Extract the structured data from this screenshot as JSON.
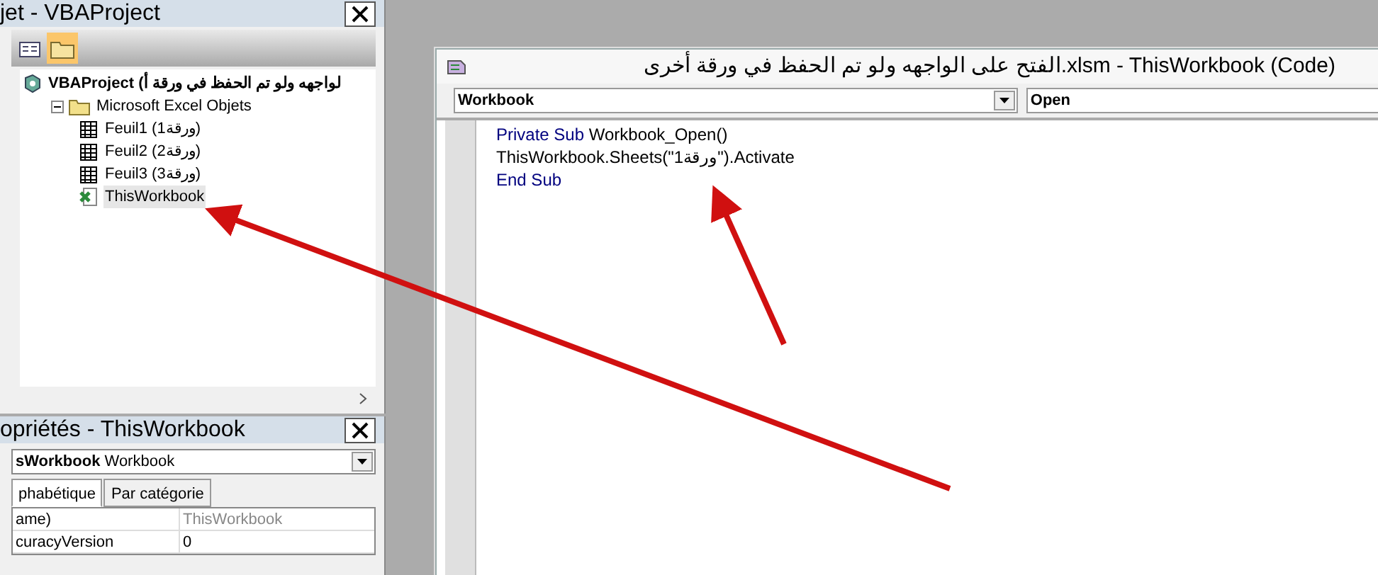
{
  "project_explorer": {
    "title": "jet - VBAProject",
    "tree": [
      {
        "label": "VBAProject (لواجهه ولو تم الحفظ في ورقة أ",
        "kind": "project",
        "children": [
          {
            "label": "Microsoft Excel Objets",
            "kind": "folder",
            "expanded": true,
            "children": [
              {
                "label": "Feuil1 (ورقة1)",
                "kind": "sheet",
                "selected": false
              },
              {
                "label": "Feuil2 (ورقة2)",
                "kind": "sheet",
                "selected": false
              },
              {
                "label": "Feuil3 (ورقة3)",
                "kind": "sheet",
                "selected": false
              },
              {
                "label": "ThisWorkbook",
                "kind": "workbook",
                "selected": true
              }
            ]
          }
        ]
      }
    ]
  },
  "properties": {
    "title": "opriétés - ThisWorkbook",
    "object_name": "sWorkbook",
    "object_type": "Workbook",
    "tabs": [
      {
        "label": "phabétique",
        "selected": true
      },
      {
        "label": "Par catégorie",
        "selected": false
      }
    ],
    "rows": [
      {
        "name": "ame)",
        "value": "ThisWorkbook",
        "greyed": true
      },
      {
        "name": "curacyVersion",
        "value": "0",
        "greyed": false
      }
    ]
  },
  "code_window": {
    "title": "الفتح على الواجهه ولو تم الحفظ في ورقة أخرى.xlsm - ThisWorkbook (Code)",
    "object_combo": "Workbook",
    "procedure_combo": "Open",
    "lines": [
      [
        {
          "text": "Private Sub ",
          "kind": "keyword"
        },
        {
          "text": "Workbook_Open()",
          "kind": "plain"
        }
      ],
      [
        {
          "text": "ThisWorkbook.Sheets(\"ورقة1\").Activate",
          "kind": "plain"
        }
      ],
      [
        {
          "text": "End Sub",
          "kind": "keyword"
        }
      ]
    ]
  }
}
